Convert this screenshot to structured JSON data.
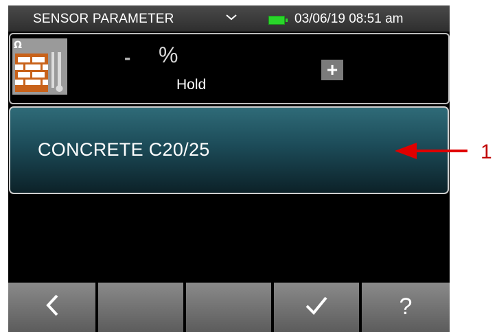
{
  "status_bar": {
    "title": "SENSOR PARAMETER",
    "datetime": "03/06/19 08:51 am",
    "battery_color": "#29d62a"
  },
  "reading": {
    "value": "-",
    "unit": "%",
    "mode": "Hold",
    "plus_label": "+",
    "sensor_icon": "brick-moisture-icon",
    "ohm_symbol": "Ω"
  },
  "material": {
    "label": "CONCRETE C20/25"
  },
  "softkeys": {
    "back_label": "<",
    "confirm_label": "✓",
    "help_label": "?"
  },
  "annotation": {
    "number": "1",
    "color": "#c00000"
  }
}
